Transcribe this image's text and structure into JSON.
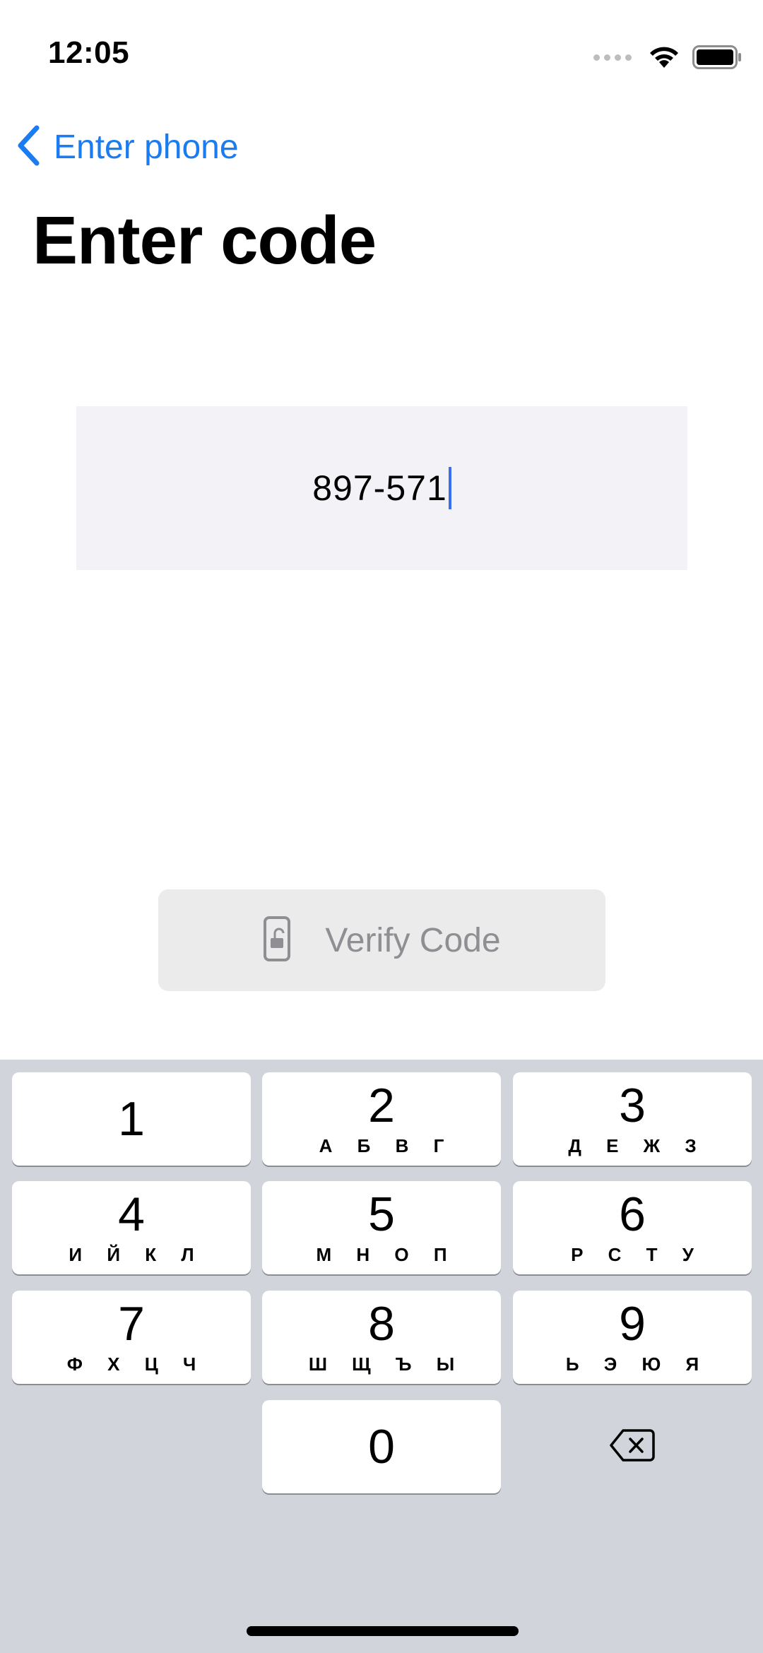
{
  "status_bar": {
    "time": "12:05",
    "icons": [
      "signal-icon",
      "wifi-icon",
      "battery-icon"
    ]
  },
  "nav": {
    "back_icon": "chevron-left-icon",
    "back_label": "Enter phone"
  },
  "page": {
    "title": "Enter code"
  },
  "code_input": {
    "value": "897-571"
  },
  "verify_button": {
    "icon": "phone-unlock-icon",
    "label": "Verify Code"
  },
  "keypad": {
    "keys": [
      {
        "digit": "1",
        "letters": ""
      },
      {
        "digit": "2",
        "letters": "А Б В Г"
      },
      {
        "digit": "3",
        "letters": "Д Е Ж З"
      },
      {
        "digit": "4",
        "letters": "И Й К Л"
      },
      {
        "digit": "5",
        "letters": "М Н О П"
      },
      {
        "digit": "6",
        "letters": "Р С Т У"
      },
      {
        "digit": "7",
        "letters": "Ф Х Ц Ч"
      },
      {
        "digit": "8",
        "letters": "Ш Щ Ъ Ы"
      },
      {
        "digit": "9",
        "letters": "Ь Э Ю Я"
      },
      {
        "digit": "0",
        "letters": ""
      }
    ],
    "delete_icon": "backspace-icon"
  },
  "colors": {
    "accent": "#1a7cf0",
    "field_bg": "#f2f2f7",
    "keyboard_bg": "#d1d4db",
    "disabled_text": "#8e8e93"
  }
}
